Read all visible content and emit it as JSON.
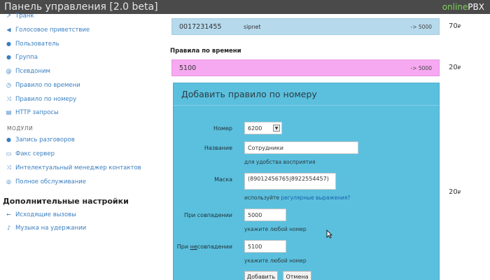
{
  "app": {
    "title": "Панель управления [2.0 beta]",
    "brand_part1": "online",
    "brand_part2": "PBX"
  },
  "sidebar": {
    "items": [
      {
        "icon": "trunk-icon",
        "glyph": "↗",
        "label": "Транк"
      },
      {
        "icon": "greeting-icon",
        "glyph": "◀",
        "label": "Голосовое приветствие"
      },
      {
        "icon": "user-icon",
        "glyph": "●",
        "label": "Пользователь"
      },
      {
        "icon": "group-icon",
        "glyph": "●",
        "label": "Группа"
      },
      {
        "icon": "alias-icon",
        "glyph": "@",
        "label": "Псевдоним"
      },
      {
        "icon": "time-rule-icon",
        "glyph": "◷",
        "label": "Правило по времени"
      },
      {
        "icon": "number-rule-icon",
        "glyph": "⤨",
        "label": "Правило по номеру"
      },
      {
        "icon": "http-icon",
        "glyph": "▤",
        "label": "HTTP запросы"
      }
    ],
    "modules_label": "МОДУЛИ",
    "modules": [
      {
        "icon": "record-icon",
        "glyph": "●",
        "label": "Запись разговоров"
      },
      {
        "icon": "fax-icon",
        "glyph": "▭",
        "label": "Факс сервер"
      },
      {
        "icon": "contacts-icon",
        "glyph": "⤨",
        "label": "Интелектуальный менеджер контактов"
      },
      {
        "icon": "service-icon",
        "glyph": "◎",
        "label": "Полное обслуживание"
      }
    ],
    "extra_title": "Дополнительные настройки",
    "extra": [
      {
        "icon": "outgoing-icon",
        "glyph": "←",
        "label": "Исходящие вызовы"
      },
      {
        "icon": "music-icon",
        "glyph": "♪",
        "label": "Музыка на удержании"
      }
    ]
  },
  "main": {
    "route1": {
      "number": "0017231455",
      "provider": "sipnet",
      "target": "-> 5000",
      "price": "70",
      "currency": "₽"
    },
    "time_rules_heading": "Правила по времени",
    "route2": {
      "number": "5100",
      "target": "-> 5000",
      "price": "20",
      "currency": "₽"
    },
    "route3": {
      "price": "20",
      "currency": "₽"
    }
  },
  "dialog": {
    "title": "Добавить правило по номеру",
    "number_label": "Номер",
    "number_value": "6200",
    "name_label": "Название",
    "name_value": "Сотрудники",
    "name_hint": "для удобства восприятия",
    "mask_label": "Маска",
    "mask_value": "(89012456765|8922554457)",
    "mask_hint_prefix": "используйте ",
    "mask_hint_link": "регулярные выражения?",
    "match_label": "При совпадении",
    "match_value": "5000",
    "match_hint": "укажите любой номер",
    "nomatch_label_prefix": "При ",
    "nomatch_label_underlined": "не",
    "nomatch_label_suffix": "совпадении",
    "nomatch_value": "5100",
    "nomatch_hint": "укажите любой номер",
    "add_button": "Добавить",
    "cancel_button": "Отмена"
  },
  "colors": {
    "topbar": "#4a4a4a",
    "link": "#3a7fc1",
    "dialog_bg": "#5bc0de",
    "row_blue": "#b6d9ec",
    "row_pink": "#f6a9f0"
  }
}
